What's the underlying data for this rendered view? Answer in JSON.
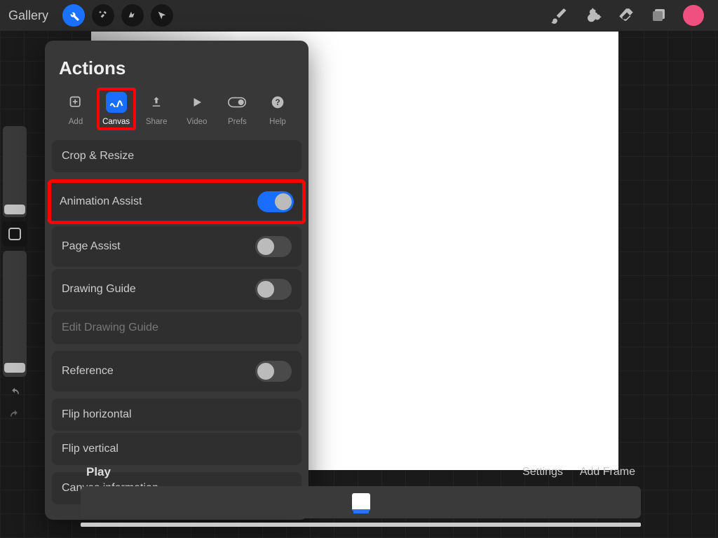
{
  "topbar": {
    "gallery": "Gallery"
  },
  "panel": {
    "title": "Actions",
    "tabs": [
      {
        "label": "Add"
      },
      {
        "label": "Canvas"
      },
      {
        "label": "Share"
      },
      {
        "label": "Video"
      },
      {
        "label": "Prefs"
      },
      {
        "label": "Help"
      }
    ],
    "rows": {
      "crop": "Crop & Resize",
      "anim": "Animation Assist",
      "page": "Page Assist",
      "guide": "Drawing Guide",
      "edit_guide": "Edit Drawing Guide",
      "reference": "Reference",
      "flip_h": "Flip horizontal",
      "flip_v": "Flip vertical",
      "info": "Canvas information"
    },
    "toggles": {
      "anim": true,
      "page": false,
      "guide": false,
      "reference": false
    }
  },
  "timeline": {
    "play": "Play",
    "settings": "Settings",
    "add_frame": "Add Frame"
  }
}
